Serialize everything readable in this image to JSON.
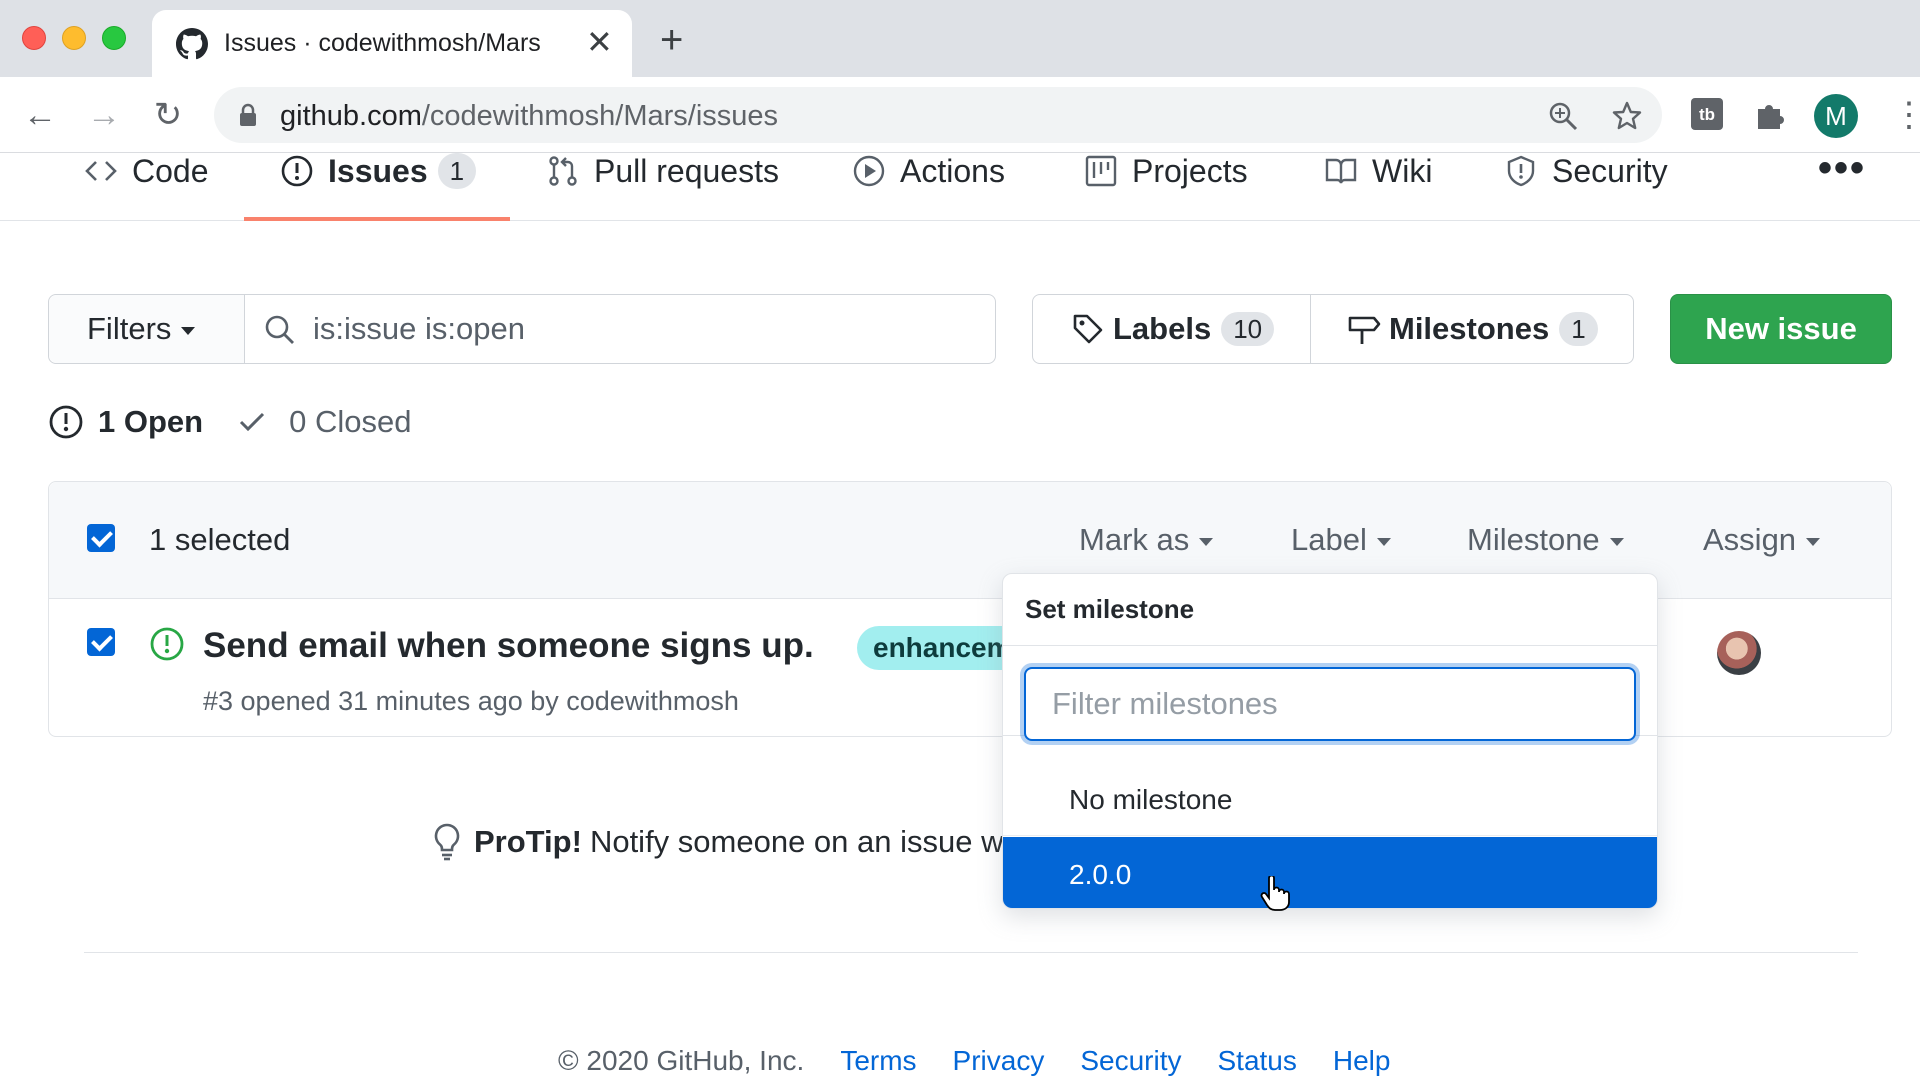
{
  "browser": {
    "tab_title": "Issues · codewithmosh/Mars",
    "url_host": "github.com",
    "url_path": "/codewithmosh/Mars/issues",
    "profile_initial": "M"
  },
  "reponav": {
    "code": "Code",
    "issues": "Issues",
    "issues_count": "1",
    "pull_requests": "Pull requests",
    "actions": "Actions",
    "projects": "Projects",
    "wiki": "Wiki",
    "security": "Security"
  },
  "subnav": {
    "filters_label": "Filters",
    "search_value": "is:issue is:open",
    "labels_label": "Labels",
    "labels_count": "10",
    "milestones_label": "Milestones",
    "milestones_count": "1",
    "new_issue_label": "New issue"
  },
  "states": {
    "open": "1 Open",
    "closed": "0 Closed"
  },
  "issues_header": {
    "selected": "1 selected",
    "mark_as": "Mark as",
    "label": "Label",
    "milestone": "Milestone",
    "assign": "Assign"
  },
  "issue": {
    "title": "Send email when someone signs up.",
    "label": "enhancement",
    "label_color": "#a2eeef",
    "meta": "#3 opened 31 minutes ago by codewithmosh"
  },
  "protip": {
    "bold": "ProTip!",
    "text": "Notify someone on an issue w"
  },
  "footer": {
    "copyright": "© 2020 GitHub, Inc.",
    "links": [
      "Terms",
      "Privacy",
      "Security",
      "Status",
      "Help"
    ]
  },
  "dropdown": {
    "title": "Set milestone",
    "filter_placeholder": "Filter milestones",
    "items": [
      "No milestone",
      "2.0.0"
    ],
    "selected_index": 1
  },
  "colors": {
    "accent": "#0366d6",
    "new_issue": "#2ea44f",
    "open_icon": "#28a745",
    "tab_underline": "#f9826c"
  }
}
